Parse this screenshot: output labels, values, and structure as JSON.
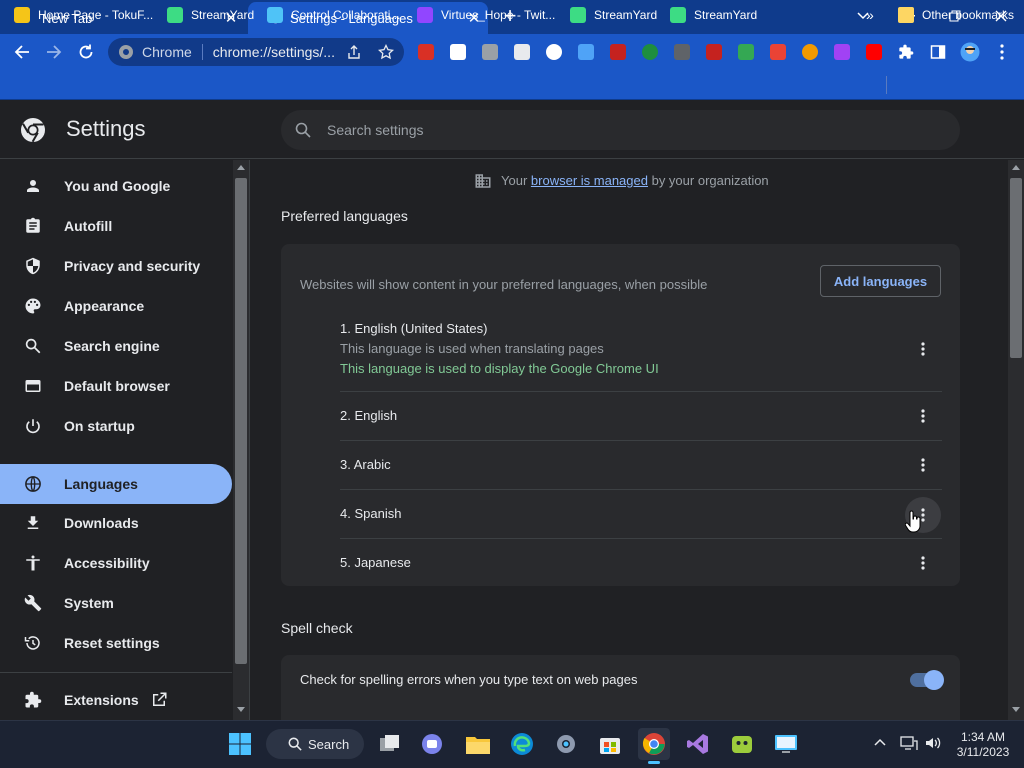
{
  "browser": {
    "tabs": [
      {
        "title": "New Tab",
        "active": false
      },
      {
        "title": "Settings - Languages",
        "active": true
      }
    ],
    "new_tab_symbol": "+",
    "omnibox": {
      "site_label": "Chrome",
      "url": "chrome://settings/..."
    },
    "bookmarks": [
      {
        "label": "Home Page - TokuF...",
        "color": "#f5c518"
      },
      {
        "label": "StreamYard",
        "color": "#3ddc84"
      },
      {
        "label": "Control Collaborati...",
        "color": "#4fc3f7"
      },
      {
        "label": "Virtues_Hope - Twit...",
        "color": "#9146ff"
      },
      {
        "label": "StreamYard",
        "color": "#3ddc84"
      },
      {
        "label": "StreamYard",
        "color": "#3ddc84"
      }
    ],
    "bookmarks_overflow": "»",
    "other_bookmarks": "Other bookmarks"
  },
  "settings": {
    "title": "Settings",
    "search_placeholder": "Search settings",
    "nav": [
      {
        "label": "You and Google",
        "icon": "person-icon"
      },
      {
        "label": "Autofill",
        "icon": "clipboard-icon"
      },
      {
        "label": "Privacy and security",
        "icon": "shield-icon"
      },
      {
        "label": "Appearance",
        "icon": "palette-icon"
      },
      {
        "label": "Search engine",
        "icon": "search-icon"
      },
      {
        "label": "Default browser",
        "icon": "browser-window-icon"
      },
      {
        "label": "On startup",
        "icon": "power-icon"
      },
      {
        "label": "Languages",
        "icon": "globe-icon",
        "selected": true
      },
      {
        "label": "Downloads",
        "icon": "download-icon"
      },
      {
        "label": "Accessibility",
        "icon": "accessibility-icon"
      },
      {
        "label": "System",
        "icon": "wrench-icon"
      },
      {
        "label": "Reset settings",
        "icon": "history-icon"
      }
    ],
    "extensions": {
      "label": "Extensions",
      "icon": "puzzle-icon"
    },
    "managed_notice": {
      "before": "Your",
      "link": "browser is managed",
      "after": "by your organization"
    },
    "preferred_languages": {
      "heading": "Preferred languages",
      "description": "Websites will show content in your preferred languages, when possible",
      "add_button": "Add languages",
      "languages": [
        {
          "name": "1. English (United States)",
          "note": "This language is used when translating pages",
          "ui_note": "This language is used to display the Google Chrome UI"
        },
        {
          "name": "2. English"
        },
        {
          "name": "3. Arabic"
        },
        {
          "name": "4. Spanish"
        },
        {
          "name": "5. Japanese"
        }
      ]
    },
    "spell_check": {
      "heading": "Spell check",
      "toggle_label": "Check for spelling errors when you type text on web pages",
      "enabled": true
    }
  },
  "taskbar": {
    "search_label": "Search",
    "time": "1:34 AM",
    "date": "3/11/2023"
  },
  "colors": {
    "accent": "#8ab4f8",
    "link": "#8ab4f8",
    "ui_note": "#81c995",
    "tab_strip": "#0f3b8c",
    "toolbar": "#1b57c7"
  }
}
